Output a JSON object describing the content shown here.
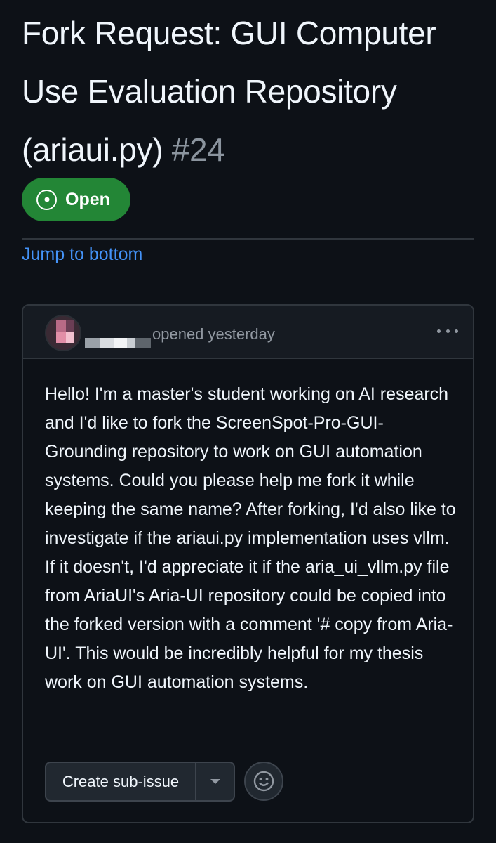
{
  "issue": {
    "title": "Fork Request: GUI Computer Use Evaluation Repository (ariaui.py)",
    "number": "#24",
    "state_label": "Open",
    "state_color": "#238636"
  },
  "navigation": {
    "jump_label": "Jump to bottom"
  },
  "comment": {
    "author_display": "",
    "opened_text": "opened yesterday",
    "body": "Hello! I'm a master's student working on AI research and I'd like to fork the ScreenSpot-Pro-GUI-Grounding repository to work on GUI automation systems. Could you please help me fork it while keeping the same name? After forking, I'd also like to investigate if the ariaui.py implementation uses vllm. If it doesn't, I'd appreciate it if the aria_ui_vllm.py file from AriaUI's Aria-UI repository could be copied into the forked version with a comment '# copy from Aria-UI'. This would be incredibly helpful for my thesis work on GUI automation systems.",
    "more_icon": "kebab-horizontal-icon"
  },
  "actions": {
    "create_subissue_label": "Create sub-issue",
    "dropdown_icon": "triangle-down-icon",
    "reaction_icon": "smiley-icon"
  },
  "colors": {
    "background": "#0d1117",
    "link": "#4493f8",
    "muted": "#9198a1",
    "border": "#30363d"
  }
}
